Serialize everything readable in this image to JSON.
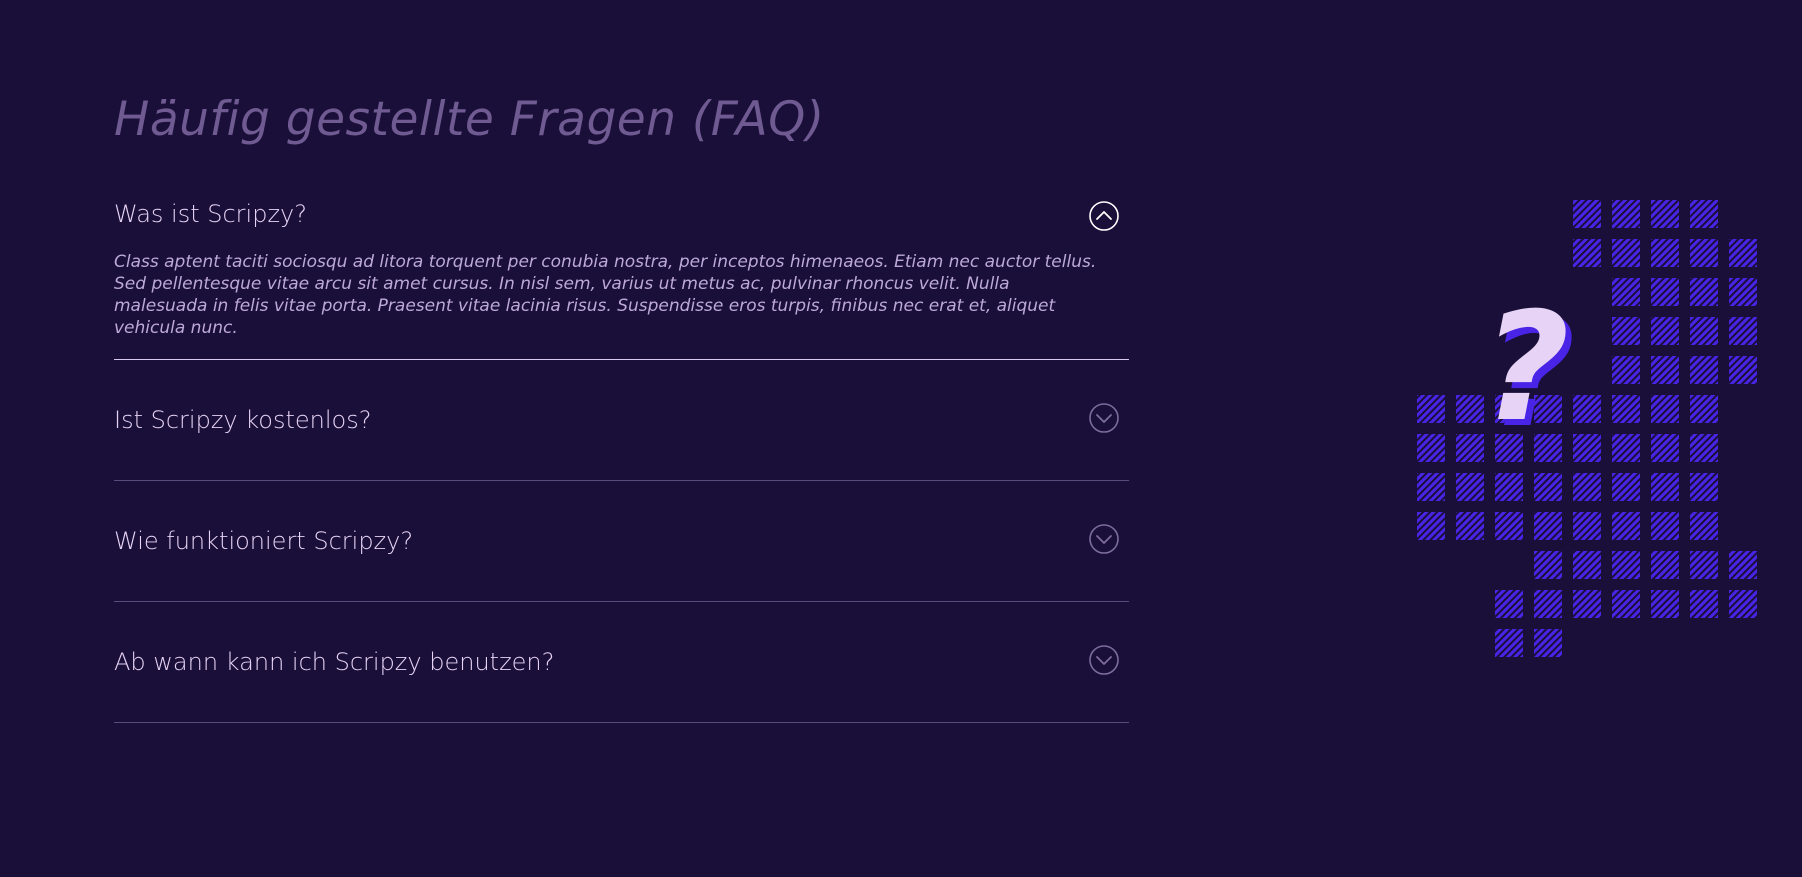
{
  "page": {
    "title": "Häufig gestellte Fragen (FAQ)"
  },
  "faq": [
    {
      "question": "Was ist Scripzy?",
      "answer": "Class aptent taciti sociosqu ad litora torquent per conubia nostra, per inceptos himenaeos. Etiam nec auctor tellus. Sed pellentesque vitae arcu sit amet cursus. In nisl sem, varius ut metus ac, pulvinar rhoncus velit. Nulla malesuada in felis vitae porta. Praesent vitae lacinia risus. Suspendisse eros turpis, finibus nec erat et, aliquet vehicula nunc.",
      "expanded": true
    },
    {
      "question": "Ist Scripzy kostenlos?",
      "expanded": false
    },
    {
      "question": "Wie funktioniert Scripzy?",
      "expanded": false
    },
    {
      "question": "Ab wann kann ich Scripzy benutzen?",
      "expanded": false
    }
  ],
  "icons": {
    "collapse": "chevron-up-circle-icon",
    "expand": "chevron-down-circle-icon",
    "illustration": "question-mark-illustration"
  },
  "colors": {
    "background": "#1a0f38",
    "title": "#6f5a92",
    "text": "#e6d3f5",
    "answer": "#bca9d8",
    "divider": "#5b4a7c",
    "divider_active": "#d8c8ee",
    "grid_tile": "#4a24e6",
    "question_mark_fill": "#e6d3f5",
    "question_mark_shadow": "#4a24e6"
  }
}
